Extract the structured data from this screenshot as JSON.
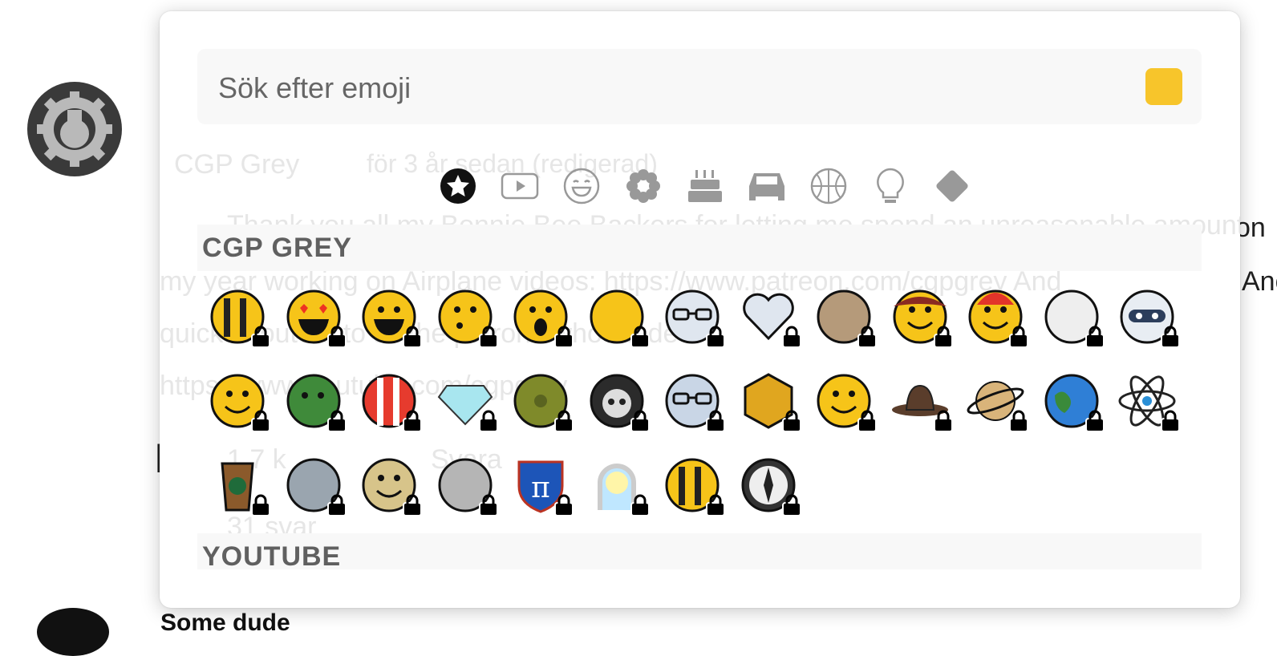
{
  "background": {
    "channel_name": "CGP Grey",
    "meta": "för 3 år sedan (redigerad)",
    "post_line1": "Thank you all my Bonnie Bee Backers for letting me spend an unreasonable amount of",
    "post_line2": "my year working on Airplane videos: https://www.patreon.com/cgpgrey And",
    "post_line3": "quick shoutout to all the patrons who made a ",
    "post_line4": "https://www.youtube.com/cgpgrey",
    "like_count": "1,7 k",
    "reply_label": "Svara",
    "replies_label": "31 svar",
    "next_commenter": "Some dude"
  },
  "search": {
    "placeholder": "Sök efter emoji"
  },
  "categories": [
    {
      "name": "channel-emoji",
      "icon": "star-circle-icon",
      "active": true
    },
    {
      "name": "youtube",
      "icon": "youtube-icon"
    },
    {
      "name": "smileys",
      "icon": "smiley-icon"
    },
    {
      "name": "nature",
      "icon": "flower-icon"
    },
    {
      "name": "food",
      "icon": "cake-icon"
    },
    {
      "name": "travel",
      "icon": "car-icon"
    },
    {
      "name": "activities",
      "icon": "basketball-icon"
    },
    {
      "name": "objects",
      "icon": "lightbulb-icon"
    },
    {
      "name": "symbols",
      "icon": "diamond-icon"
    }
  ],
  "sections": [
    {
      "title": "CGP GREY"
    },
    {
      "title": "YOUTUBE"
    }
  ],
  "emoji_icons": [
    "bee-icon",
    "heart-eyes-icon",
    "laughing-icon",
    "whistle-icon",
    "surprised-icon",
    "hand-sanitizer-icon",
    "glasses-face-icon",
    "heart-icon",
    "coconut-icon",
    "hat-face-icon",
    "red-hat-face-icon",
    "chicken-top-hat-icon",
    "robot-icon",
    "smile-icon",
    "green-blob-icon",
    "popcorn-icon",
    "diamond-gem-icon",
    "virus-icon",
    "grim-reaper-icon",
    "robot-paperclip-icon",
    "hexagon-icon",
    "thinking-icon",
    "fedora-icon",
    "saturn-icon",
    "earth-icon",
    "atom-icon",
    "coffee-cup-icon",
    "shark-icon",
    "blonde-lady-icon",
    "queen-icon",
    "pi-sign-icon",
    "portal-icon",
    "pilot-bee-icon",
    "compass-icon"
  ],
  "colors": {
    "skin_tone": "#f7c52b",
    "section_bg": "#f8f8f8",
    "section_text": "#606060"
  }
}
